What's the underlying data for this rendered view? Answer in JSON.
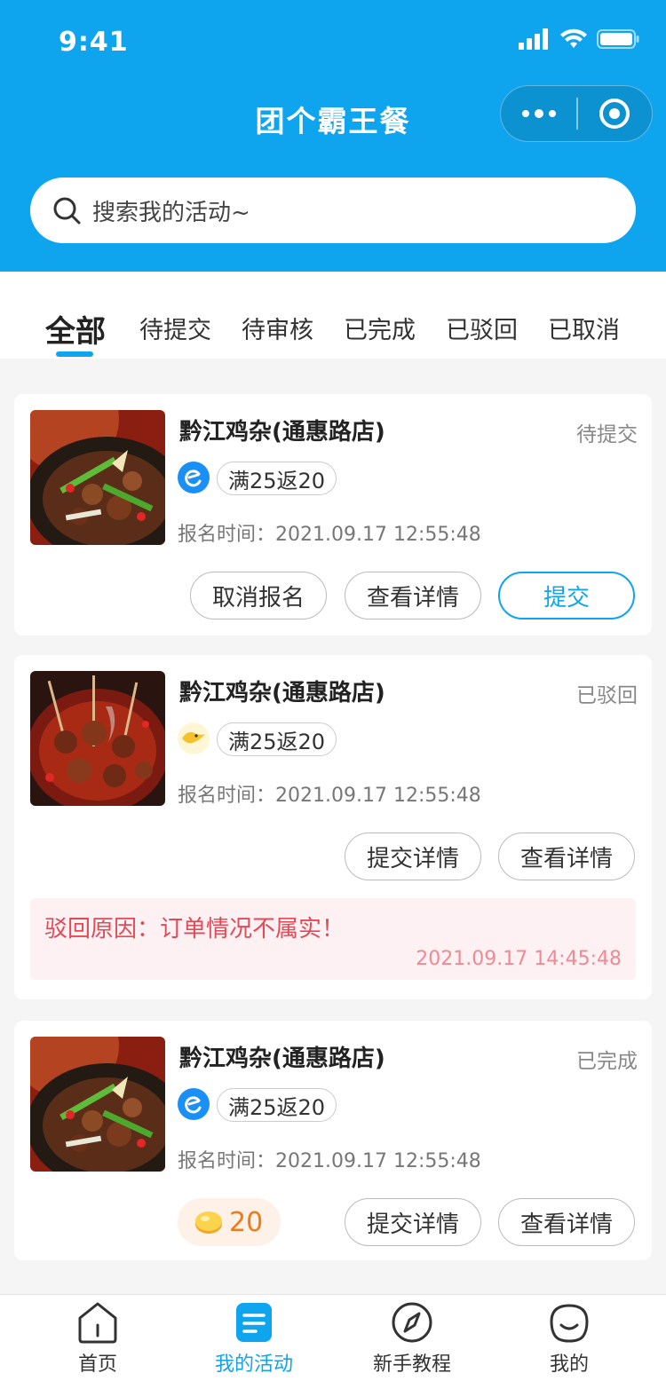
{
  "status_bar": {
    "time": "9:41"
  },
  "nav": {
    "title": "团个霸王餐"
  },
  "search": {
    "placeholder": "搜索我的活动~"
  },
  "tabs": [
    "全部",
    "待提交",
    "待审核",
    "已完成",
    "已驳回",
    "已取消"
  ],
  "active_tab": "全部",
  "cards": [
    {
      "shop": "黔江鸡杂(通惠路店)",
      "status": "待提交",
      "platform_icon": "eleme-icon",
      "promo": "满25返20",
      "reg_time": "报名时间：2021.09.17 12:55:48",
      "buttons": [
        "取消报名",
        "查看详情",
        "提交"
      ]
    },
    {
      "shop": "黔江鸡杂(通惠路店)",
      "status": "已驳回",
      "platform_icon": "meituan-icon",
      "promo": "满25返20",
      "reg_time": "报名时间：2021.09.17 12:55:48",
      "buttons": [
        "提交详情",
        "查看详情"
      ],
      "reject_reason": "驳回原因：订单情况不属实！",
      "reject_time": "2021.09.17 14:45:48"
    },
    {
      "shop": "黔江鸡杂(通惠路店)",
      "status": "已完成",
      "platform_icon": "eleme-icon",
      "promo": "满25返20",
      "reg_time": "报名时间：2021.09.17 12:55:48",
      "coins": "20",
      "buttons": [
        "提交详情",
        "查看详情"
      ]
    }
  ],
  "tabbar": [
    {
      "label": "首页",
      "icon": "home-icon"
    },
    {
      "label": "我的活动",
      "icon": "activity-icon"
    },
    {
      "label": "新手教程",
      "icon": "compass-icon"
    },
    {
      "label": "我的",
      "icon": "profile-icon"
    }
  ],
  "colors": {
    "brand": "#0ea5ee",
    "reject_text": "#e24a56",
    "coin": "#ef7a1a"
  }
}
